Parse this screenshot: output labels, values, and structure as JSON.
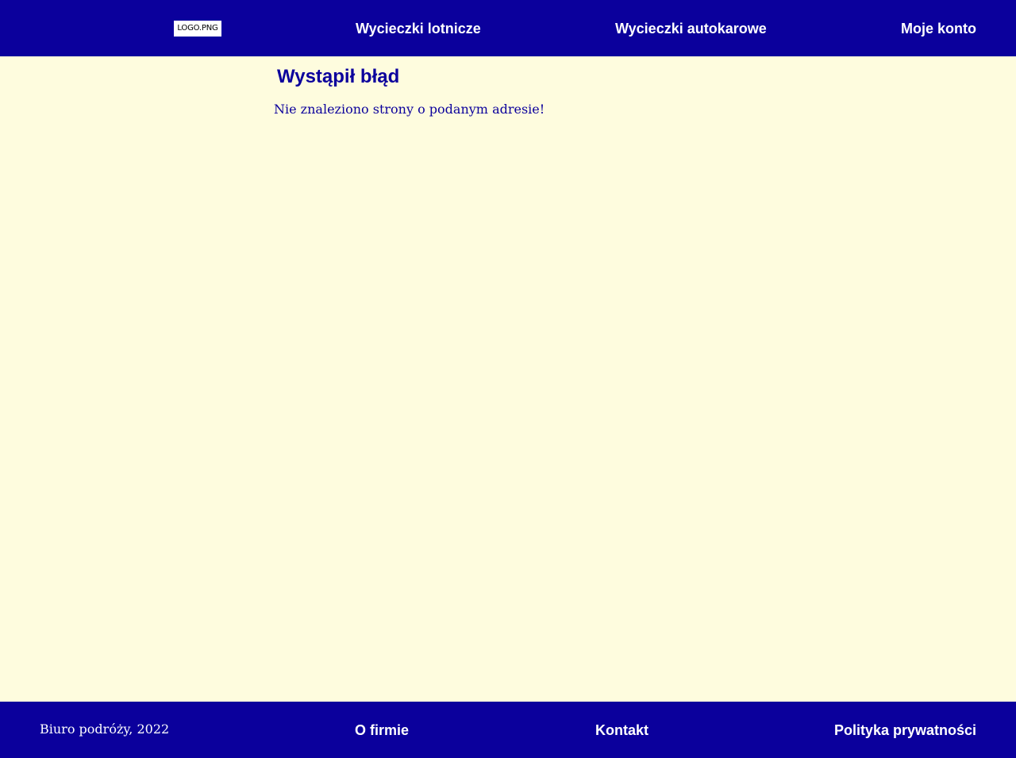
{
  "header": {
    "logo_text": "LOGO.PNG",
    "nav": {
      "flights": "Wycieczki lotnicze",
      "coach": "Wycieczki autokarowe",
      "account": "Moje konto"
    }
  },
  "main": {
    "error_title": "Wystąpił błąd",
    "error_message": "Nie znaleziono strony o podanym adresie!"
  },
  "footer": {
    "copyright": "Biuro podróży, 2022",
    "links": {
      "about": "O firmie",
      "contact": "Kontakt",
      "privacy": "Polityka prywatności"
    }
  },
  "colors": {
    "header_bg": "#0b009c",
    "page_bg": "#fefcde",
    "accent_text": "#0b009c",
    "nav_text": "#ffffff"
  }
}
